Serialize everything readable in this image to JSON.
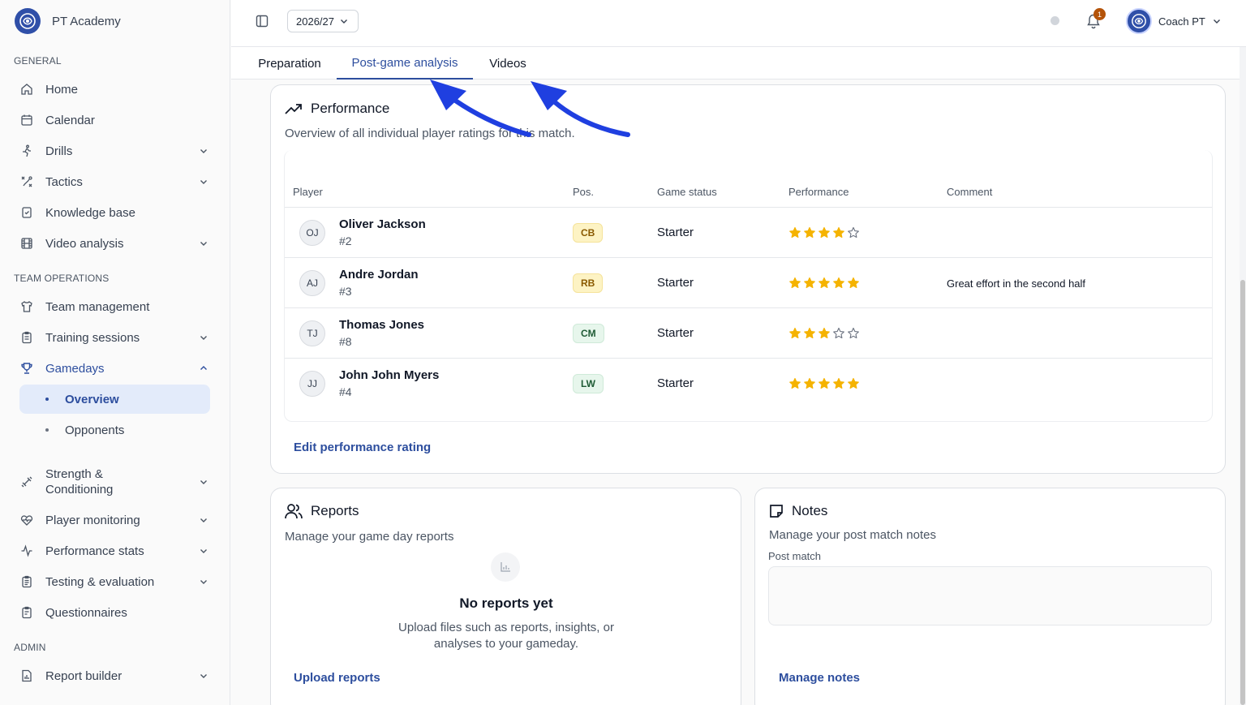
{
  "brand": {
    "name": "PT Academy"
  },
  "sidebar": {
    "sections": {
      "general": "GENERAL",
      "team_operations": "TEAM OPERATIONS",
      "admin": "ADMIN"
    },
    "items": {
      "home": "Home",
      "calendar": "Calendar",
      "drills": "Drills",
      "tactics": "Tactics",
      "knowledge_base": "Knowledge base",
      "video_analysis": "Video analysis",
      "team_management": "Team management",
      "training_sessions": "Training sessions",
      "gamedays": "Gamedays",
      "overview": "Overview",
      "opponents": "Opponents",
      "strength_line1": "Strength &",
      "strength_line2": "Conditioning",
      "player_monitoring": "Player monitoring",
      "performance_stats": "Performance stats",
      "testing_evaluation": "Testing & evaluation",
      "questionnaires": "Questionnaires",
      "report_builder": "Report builder"
    }
  },
  "topbar": {
    "season": "2026/27",
    "notifications_count": "1",
    "user_name": "Coach PT"
  },
  "tabs": [
    "Preparation",
    "Post-game analysis",
    "Videos"
  ],
  "performance": {
    "title": "Performance",
    "subtitle": "Overview of all individual player ratings for this match.",
    "columns": {
      "player": "Player",
      "pos": "Pos.",
      "status": "Game status",
      "performance": "Performance",
      "comment": "Comment"
    },
    "rows": [
      {
        "initials": "OJ",
        "name": "Oliver Jackson",
        "number": "#2",
        "pos": "CB",
        "pos_color": "yellow",
        "status": "Starter",
        "rating": 4,
        "comment": ""
      },
      {
        "initials": "AJ",
        "name": "Andre Jordan",
        "number": "#3",
        "pos": "RB",
        "pos_color": "yellow",
        "status": "Starter",
        "rating": 5,
        "comment": "Great effort in the second half"
      },
      {
        "initials": "TJ",
        "name": "Thomas Jones",
        "number": "#8",
        "pos": "CM",
        "pos_color": "green",
        "status": "Starter",
        "rating": 3,
        "comment": ""
      },
      {
        "initials": "JJ",
        "name": "John John Myers",
        "number": "#4",
        "pos": "LW",
        "pos_color": "green",
        "status": "Starter",
        "rating": 5,
        "comment": ""
      }
    ],
    "edit_link": "Edit performance rating"
  },
  "reports": {
    "title": "Reports",
    "subtitle": "Manage your game day reports",
    "empty_title": "No reports yet",
    "empty_text": "Upload files such as reports, insights, or analyses to your gameday.",
    "upload_link": "Upload reports"
  },
  "notes": {
    "title": "Notes",
    "subtitle": "Manage your post match notes",
    "field_label": "Post match",
    "field_value": "",
    "manage_link": "Manage notes"
  },
  "colors": {
    "accent": "#2d4e9e",
    "star": "#f5b301",
    "arrow": "#1f3fe0"
  }
}
